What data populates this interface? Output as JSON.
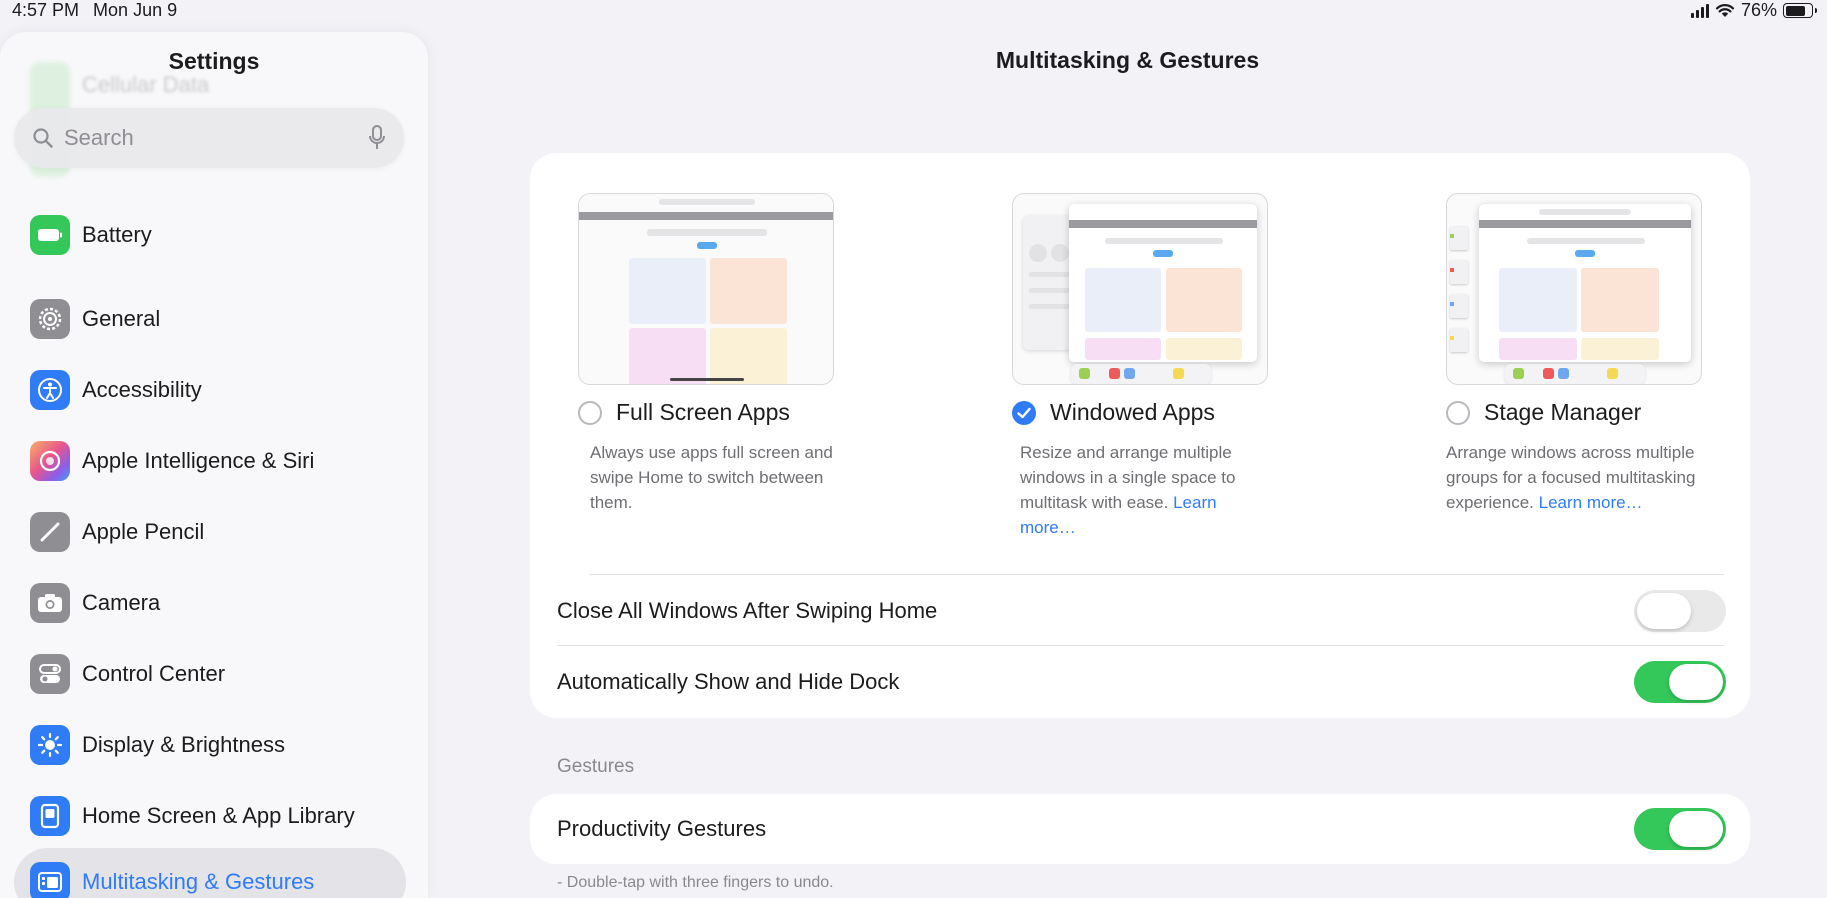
{
  "status_bar": {
    "time": "4:57 PM",
    "date": "Mon Jun 9",
    "battery_percent": "76%",
    "signal_bars": 4,
    "battery_level": 0.76
  },
  "sidebar": {
    "title": "Settings",
    "ghost_item_label": "Cellular Data",
    "search": {
      "placeholder": "Search",
      "icon": "magnifying-glass-icon",
      "mic_icon": "microphone-icon"
    },
    "items": [
      {
        "label": "Battery",
        "icon": "battery-icon",
        "color": "#34c759"
      },
      {
        "label": "General",
        "icon": "gear-icon",
        "color": "#8e8e93"
      },
      {
        "label": "Accessibility",
        "icon": "accessibility-icon",
        "color": "#2f7cf6"
      },
      {
        "label": "Apple Intelligence & Siri",
        "icon": "siri-icon",
        "color": "#c66bd6"
      },
      {
        "label": "Apple Pencil",
        "icon": "pencil-icon",
        "color": "#8e8e93"
      },
      {
        "label": "Camera",
        "icon": "camera-icon",
        "color": "#8e8e93"
      },
      {
        "label": "Control Center",
        "icon": "toggles-icon",
        "color": "#8e8e93"
      },
      {
        "label": "Display & Brightness",
        "icon": "sun-icon",
        "color": "#2f7cf6"
      },
      {
        "label": "Home Screen & App Library",
        "icon": "home-screen-icon",
        "color": "#2f7cf6"
      },
      {
        "label": "Multitasking & Gestures",
        "icon": "multitasking-icon",
        "color": "#2f7cf6",
        "selected": true
      }
    ]
  },
  "main": {
    "title": "Multitasking & Gestures",
    "options": [
      {
        "label": "Full Screen Apps",
        "checked": false,
        "desc": "Always use apps full screen and swipe Home to switch between them.",
        "learn_more": ""
      },
      {
        "label": "Windowed Apps",
        "checked": true,
        "desc": "Resize and arrange multiple windows in a single space to multitask with ease.",
        "learn_more": "Learn more…"
      },
      {
        "label": "Stage Manager",
        "checked": false,
        "desc": "Arrange windows across multiple groups for a focused multitasking experience.",
        "learn_more": "Learn more…"
      }
    ],
    "toggles": [
      {
        "label": "Close All Windows After Swiping Home",
        "on": false
      },
      {
        "label": "Automatically Show and Hide Dock",
        "on": true
      }
    ],
    "gestures_header": "Gestures",
    "gestures": [
      {
        "label": "Productivity Gestures",
        "on": true
      }
    ],
    "footnote": "- Double-tap with three fingers to undo."
  },
  "colors": {
    "accent": "#2f7cf6",
    "toggle_on": "#34c759",
    "toggle_off": "#e9e9ea",
    "background": "#f2f2f7"
  }
}
